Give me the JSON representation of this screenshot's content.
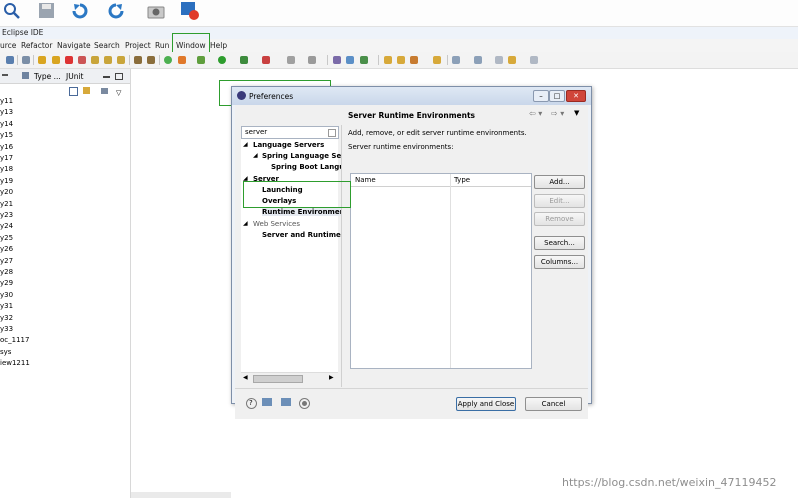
{
  "window": {
    "title": "Eclipse IDE"
  },
  "menu": [
    "urce",
    "Refactor",
    "Navigate",
    "Search",
    "Project",
    "Run",
    "Window",
    "Help"
  ],
  "left_panel": {
    "tabs": [
      "Type ...",
      "JUnit"
    ],
    "projects": [
      "y11",
      "y13",
      "y14",
      "y15",
      "y16",
      "y17",
      "y18",
      "y19",
      "y20",
      "y21",
      "y23",
      "y24",
      "y25",
      "y26",
      "y27",
      "y28",
      "y29",
      "y30",
      "y31",
      "y32",
      "y33",
      "oc_1117",
      "sys",
      "iew1211"
    ]
  },
  "dialog": {
    "title": "Preferences",
    "filter_text": "server",
    "tree": {
      "language_servers": "Language Servers",
      "spring_language_server": "Spring Language Ser",
      "spring_boot": "Spring Boot Langu",
      "server": "Server",
      "launching": "Launching",
      "overlays": "Overlays",
      "runtime_environments": "Runtime Environments",
      "web_services": "Web Services",
      "server_and_runtime": "Server and Runtime"
    },
    "page_title": "Server Runtime Environments",
    "description": "Add, remove, or edit server runtime environments.",
    "list_label": "Server runtime environments:",
    "columns": [
      "Name",
      "Type"
    ],
    "buttons": {
      "add": "Add...",
      "edit": "Edit...",
      "remove": "Remove",
      "search": "Search...",
      "columns": "Columns..."
    },
    "apply_close": "Apply and Close",
    "cancel": "Cancel"
  },
  "watermark": "https://blog.csdn.net/weixin_47119452",
  "colors": {
    "highlight": "#2e9d2e",
    "accent": "#3a6ea5"
  }
}
